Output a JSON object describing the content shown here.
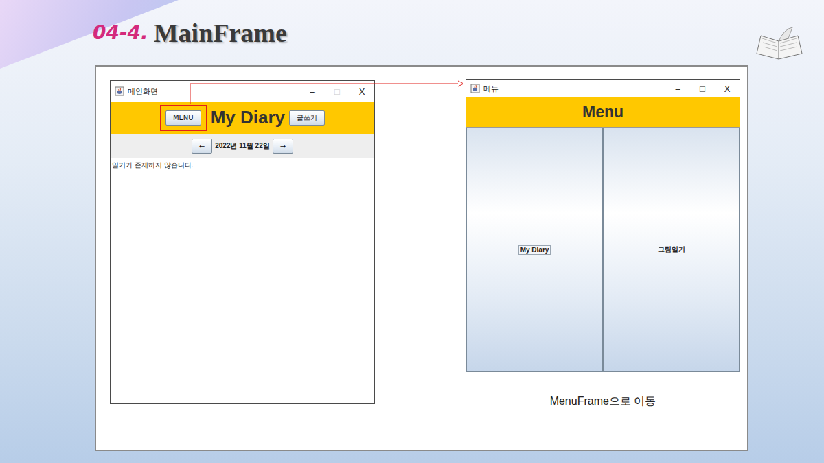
{
  "slide": {
    "number": "04-4.",
    "title": "MainFrame"
  },
  "main_window": {
    "title": "메인화면",
    "controls": [
      {
        "label": "–",
        "disabled": false
      },
      {
        "label": "□",
        "disabled": true
      },
      {
        "label": "X",
        "disabled": false
      }
    ],
    "menu_button": {
      "label": "MENU",
      "highlighted": true
    },
    "heading": "My Diary",
    "write_button": "글쓰기",
    "prev_button": "←",
    "date": "2022년 11월 22일",
    "next_button": "→",
    "content": "일기가 존재하지 않습니다."
  },
  "menu_window": {
    "title": "메뉴",
    "controls": [
      {
        "label": "–",
        "disabled": false
      },
      {
        "label": "□",
        "disabled": false
      },
      {
        "label": "X",
        "disabled": false
      }
    ],
    "heading": "Menu",
    "buttons": [
      {
        "label": "My Diary",
        "focused": true
      },
      {
        "label": "그림일기",
        "focused": false
      }
    ]
  },
  "caption": "MenuFrame으로 이동"
}
